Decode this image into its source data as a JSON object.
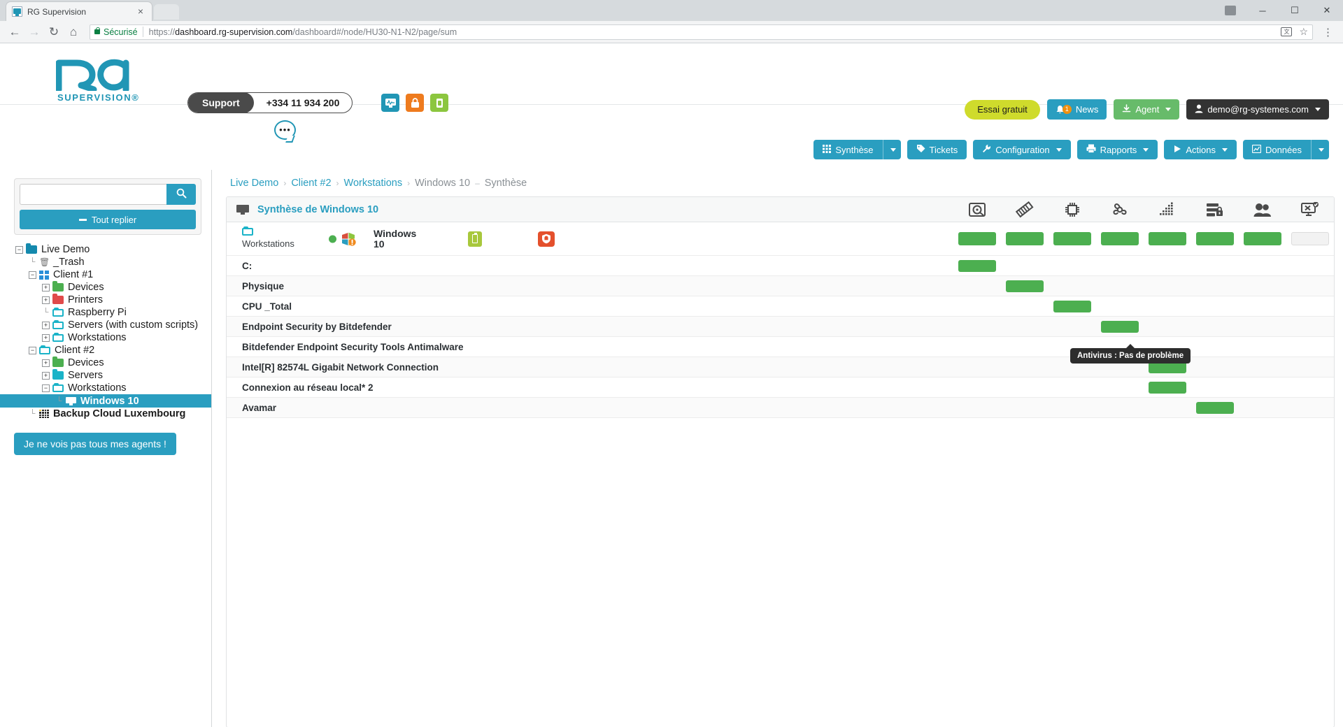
{
  "browser": {
    "tab_title": "RG Supervision",
    "tab_close": "×",
    "back_icon": "←",
    "forward_icon": "→",
    "reload_icon": "↻",
    "home_icon": "⌂",
    "secure_label": "Sécurisé",
    "url_scheme": "https://",
    "url_host": "dashboard.rg-supervision.com",
    "url_path": "/dashboard#/node/HU30-N1-N2/page/sum",
    "translate_label": "文",
    "star_icon": "☆",
    "menu_icon": "⋮",
    "minimize": "─",
    "maximize": "☐",
    "close": "✕"
  },
  "header": {
    "logo_text": "RG",
    "logo_sub": "SUPERVISION®",
    "support_label": "Support",
    "support_phone": "+334 11 934 200",
    "chat_dots": "•••",
    "icon1": "▣",
    "icon2": "⚿",
    "icon3": "☰",
    "trial_button": "Essai gratuit",
    "news_button": "News",
    "news_badge": "1",
    "agent_button": "Agent",
    "user_button": "demo@rg-systemes.com"
  },
  "nav": {
    "buttons": [
      {
        "label": "Synthèse",
        "icon": "∷",
        "split": true,
        "caret": false
      },
      {
        "label": "Tickets",
        "icon": "⚑",
        "split": false,
        "caret": false
      },
      {
        "label": "Configuration",
        "icon": "⚒",
        "split": false,
        "caret": true
      },
      {
        "label": "Rapports",
        "icon": "⎙",
        "split": false,
        "caret": true
      },
      {
        "label": "Actions",
        "icon": "▶",
        "split": false,
        "caret": true
      },
      {
        "label": "Données",
        "icon": "▦",
        "split": true,
        "caret": false
      }
    ]
  },
  "sidebar": {
    "search_placeholder": "",
    "search_value": "",
    "search_icon": "⌕",
    "collapse_label": "Tout replier",
    "agents_button": "Je ne vois pas tous mes agents !",
    "tree": [
      {
        "label": "Live Demo",
        "depth": 0,
        "expander": "minus",
        "icon": "folder-blue",
        "selected": false
      },
      {
        "label": "_Trash",
        "depth": 1,
        "expander": "none",
        "icon": "trash",
        "selected": false
      },
      {
        "label": "Client #1",
        "depth": 1,
        "expander": "minus",
        "icon": "windows",
        "selected": false
      },
      {
        "label": "Devices",
        "depth": 2,
        "expander": "plus",
        "icon": "folder-green",
        "selected": false
      },
      {
        "label": "Printers",
        "depth": 2,
        "expander": "plus",
        "icon": "folder-red",
        "selected": false
      },
      {
        "label": "Raspberry Pi",
        "depth": 2,
        "expander": "none",
        "icon": "folder-open",
        "selected": false
      },
      {
        "label": "Servers (with custom scripts)",
        "depth": 2,
        "expander": "plus",
        "icon": "folder-open",
        "selected": false
      },
      {
        "label": "Workstations",
        "depth": 2,
        "expander": "plus",
        "icon": "folder-open",
        "selected": false
      },
      {
        "label": "Client #2",
        "depth": 1,
        "expander": "minus",
        "icon": "folder-open",
        "selected": false
      },
      {
        "label": "Devices",
        "depth": 2,
        "expander": "plus",
        "icon": "folder-green",
        "selected": false
      },
      {
        "label": "Servers",
        "depth": 2,
        "expander": "plus",
        "icon": "folder-blue",
        "selected": false
      },
      {
        "label": "Workstations",
        "depth": 2,
        "expander": "minus",
        "icon": "folder-open",
        "selected": false
      },
      {
        "label": "Windows 10",
        "depth": 3,
        "expander": "none",
        "icon": "monitor",
        "selected": true
      },
      {
        "label": "Backup Cloud Luxembourg",
        "depth": 1,
        "expander": "none",
        "icon": "grid",
        "selected": false
      }
    ]
  },
  "breadcrumb": {
    "items": [
      "Live Demo",
      "Client #2",
      "Workstations"
    ],
    "current": "Windows 10",
    "page": "Synthèse",
    "sep": "›",
    "dash": "–"
  },
  "panel": {
    "title": "Synthèse de Windows 10",
    "columns": [
      {
        "name": "disk-icon",
        "glyph": "⛁"
      },
      {
        "name": "memory-icon",
        "glyph": "▀"
      },
      {
        "name": "cpu-icon",
        "glyph": "▣"
      },
      {
        "name": "antivirus-icon",
        "glyph": "☣"
      },
      {
        "name": "network-icon",
        "glyph": "▒"
      },
      {
        "name": "backup-icon",
        "glyph": "⛃"
      },
      {
        "name": "users-icon",
        "glyph": "⛹"
      },
      {
        "name": "remote-icon",
        "glyph": "☐"
      }
    ],
    "host": {
      "group_label": "Workstations",
      "name": "Windows 10",
      "status": "ok",
      "statuses": [
        "green",
        "green",
        "green",
        "green",
        "green",
        "green",
        "green",
        "empty"
      ]
    },
    "rows": [
      {
        "label": "C:",
        "col": 0,
        "status": "green"
      },
      {
        "label": "Physique",
        "col": 1,
        "status": "green"
      },
      {
        "label": "CPU _Total",
        "col": 2,
        "status": "green"
      },
      {
        "label": "Endpoint Security by Bitdefender",
        "col": 3,
        "status": "green"
      },
      {
        "label": "Bitdefender Endpoint Security Tools Antimalware",
        "col": 3,
        "status": "none"
      },
      {
        "label": "Intel[R] 82574L Gigabit Network Connection",
        "col": 4,
        "status": "green"
      },
      {
        "label": "Connexion au réseau local* 2",
        "col": 4,
        "status": "green"
      },
      {
        "label": "Avamar",
        "col": 5,
        "status": "green"
      }
    ],
    "tooltip": "Antivirus : Pas de problème"
  },
  "colors": {
    "brand_teal": "#2a9ec0",
    "status_green": "#4caf50",
    "trial_yellow": "#cfdb2c",
    "agent_green": "#67bb6a",
    "alert_red": "#e4502c"
  }
}
